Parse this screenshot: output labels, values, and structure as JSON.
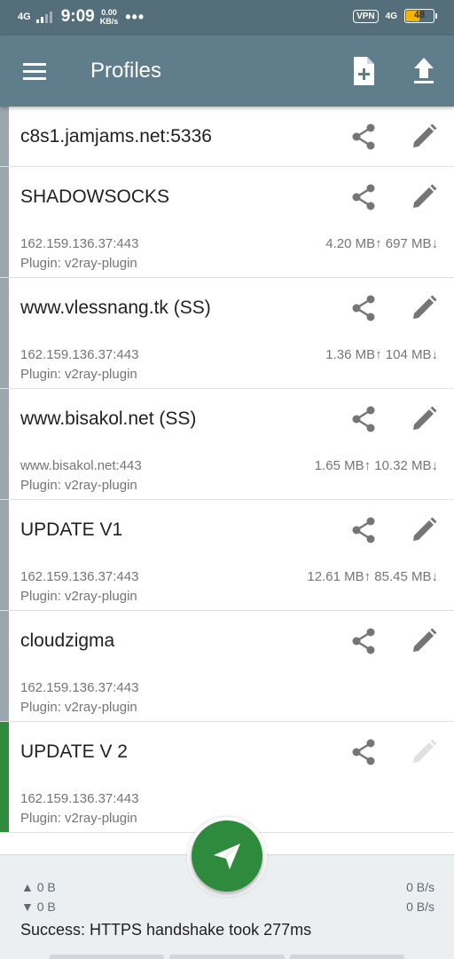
{
  "status_bar": {
    "network": "4G",
    "time": "9:09",
    "speed_value": "0.00",
    "speed_unit": "KB/s",
    "dots": "•••",
    "vpn": "VPN",
    "network_right": "4G",
    "battery": "48"
  },
  "app_bar": {
    "title": "Profiles",
    "icons": [
      "menu-icon",
      "add-file-icon",
      "upload-icon"
    ]
  },
  "profiles": [
    {
      "title": "c8s1.jamjams.net:5336",
      "host": "",
      "plugin": "",
      "traffic": "",
      "selected": false
    },
    {
      "title": "SHADOWSOCKS",
      "host": "162.159.136.37:443",
      "plugin": "Plugin: v2ray-plugin",
      "traffic": "4.20 MB↑ 697 MB↓",
      "selected": false
    },
    {
      "title": "www.vlessnang.tk (SS)",
      "host": "162.159.136.37:443",
      "plugin": "Plugin: v2ray-plugin",
      "traffic": "1.36 MB↑ 104 MB↓",
      "selected": false
    },
    {
      "title": "www.bisakol.net (SS)",
      "host": "www.bisakol.net:443",
      "plugin": "Plugin: v2ray-plugin",
      "traffic": "1.65 MB↑ 10.32 MB↓",
      "selected": false
    },
    {
      "title": "UPDATE V1",
      "host": "162.159.136.37:443",
      "plugin": "Plugin: v2ray-plugin",
      "traffic": "12.61 MB↑  85.45 MB↓",
      "selected": false
    },
    {
      "title": "cloudzigma",
      "host": "162.159.136.37:443",
      "plugin": "Plugin: v2ray-plugin",
      "traffic": "",
      "selected": false
    },
    {
      "title": "UPDATE V 2",
      "host": "162.159.136.37:443",
      "plugin": "Plugin: v2ray-plugin",
      "traffic": "",
      "selected": true
    }
  ],
  "stats": {
    "tx_total": "▲ 0 B",
    "rx_total": "▼ 0 B",
    "tx_rate": "0 B/s",
    "rx_rate": "0 B/s",
    "message": "Success: HTTPS handshake took 277ms"
  },
  "colors": {
    "toolbar": "#607d8b",
    "status_bar": "#546e7a",
    "accent": "#2e8b3e",
    "stripe_inactive": "#9aa8ae"
  }
}
